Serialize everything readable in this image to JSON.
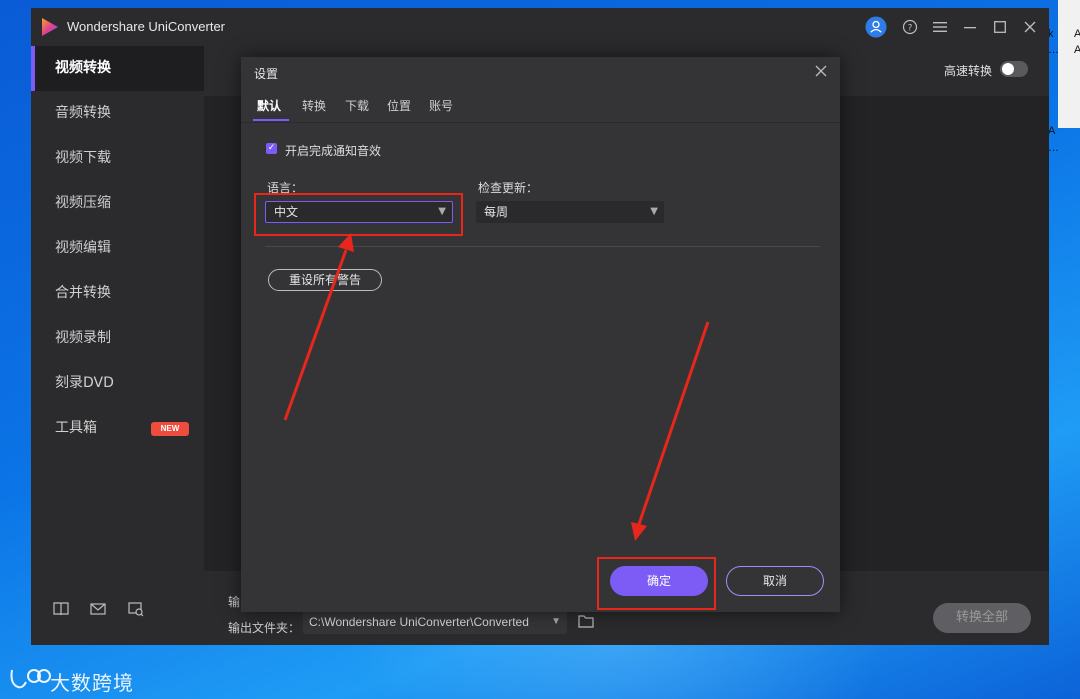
{
  "app": {
    "title": "Wondershare UniConverter",
    "accent_color": "#7d5cf5",
    "titlebar_icons": [
      "user-icon",
      "help-icon",
      "menu-icon",
      "minimize-icon",
      "maximize-icon",
      "close-icon"
    ]
  },
  "sidebar": {
    "items": [
      {
        "label": "视频转换",
        "active": true
      },
      {
        "label": "音频转换"
      },
      {
        "label": "视频下载"
      },
      {
        "label": "视频压缩"
      },
      {
        "label": "视频编辑"
      },
      {
        "label": "合并转换"
      },
      {
        "label": "视频录制"
      },
      {
        "label": "刻录DVD"
      },
      {
        "label": "工具箱",
        "badge": "NEW"
      }
    ],
    "footer_icons": [
      "book-icon",
      "mail-icon",
      "feedback-icon"
    ]
  },
  "main": {
    "turbo_label": "高速转换",
    "turbo_enabled": false,
    "output_label_partial": "输",
    "output_folder_label": "输出文件夹：",
    "output_folder_path": "C:\\Wondershare UniConverter\\Converted",
    "convert_all_label": "转换全部"
  },
  "dialog": {
    "title": "设置",
    "tabs": [
      {
        "label": "默认",
        "active": true
      },
      {
        "label": "转换"
      },
      {
        "label": "下载"
      },
      {
        "label": "位置"
      },
      {
        "label": "账号"
      }
    ],
    "notify_sound_label": "开启完成通知音效",
    "notify_sound_checked": true,
    "language_label": "语言：",
    "language_value": "中文",
    "update_label": "检查更新：",
    "update_value": "每周",
    "reset_button": "重设所有警告",
    "ok_button": "确定",
    "cancel_button": "取消"
  },
  "annotations": {
    "highlight_color": "#e8261c"
  },
  "watermark": {
    "text": "大数跨境"
  }
}
